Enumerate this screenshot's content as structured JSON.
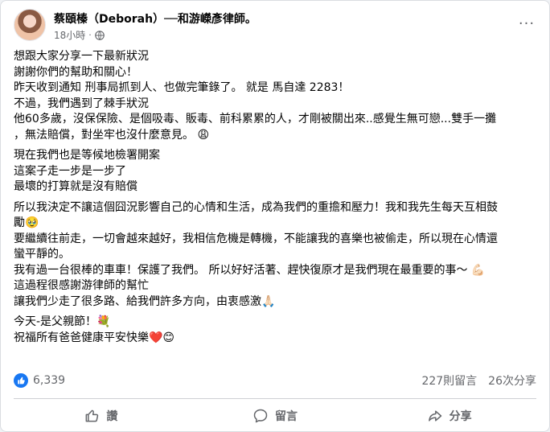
{
  "post": {
    "author": "蔡頤榛（Deborah）──和游嶸彥律師。",
    "time": "18小時",
    "privacy_icon": "globe-icon",
    "more_icon": "more-icon",
    "paragraphs": [
      {
        "lines": [
          "想跟大家分享一下最新狀況",
          "謝謝你們的幫助和關心！",
          "昨天收到通知 刑事局抓到人、也做完筆錄了。 就是 馬自達 2283！",
          "不過，我們遇到了棘手狀況",
          "他60多歲，沒保保險、是個吸毒、販毒、前科累累的人，才剛被關出來..感覺生無可戀...雙手一攤",
          "，無法賠償，對坐牢也沒什麼意見。 😩"
        ]
      },
      {
        "lines": [
          "現在我們也是等候地檢署開案",
          "這案子走一步是一步了",
          "最壞的打算就是沒有賠償"
        ]
      },
      {
        "lines": [
          "所以我決定不讓這個囧況影響自己的心情和生活，成為我們的重擔和壓力！我和我先生每天互相鼓",
          "勵🥹",
          "要繼續往前走，一切會越來越好，我相信危機是轉機，不能讓我的喜樂也被偷走，所以現在心情還",
          "蠻平靜的。",
          "我有過一台很棒的車車！保護了我們。 所以好好活著、趕快復原才是我們現在最重要的事～ 💪🏻",
          "這過程很感謝游律師的幫忙",
          "讓我們少走了很多路、給我們許多方向，由衷感激🙏🏻"
        ]
      },
      {
        "lines": [
          "今天-是父親節！💐",
          "祝福所有爸爸健康平安快樂❤️😊"
        ]
      }
    ],
    "reaction_count": "6,339",
    "comments": "227則留言",
    "shares": "26次分享",
    "actions": {
      "like": "讚",
      "comment": "留言",
      "share": "分享"
    },
    "colors": {
      "accent": "#1877f2",
      "secondary_text": "#65676b"
    }
  }
}
